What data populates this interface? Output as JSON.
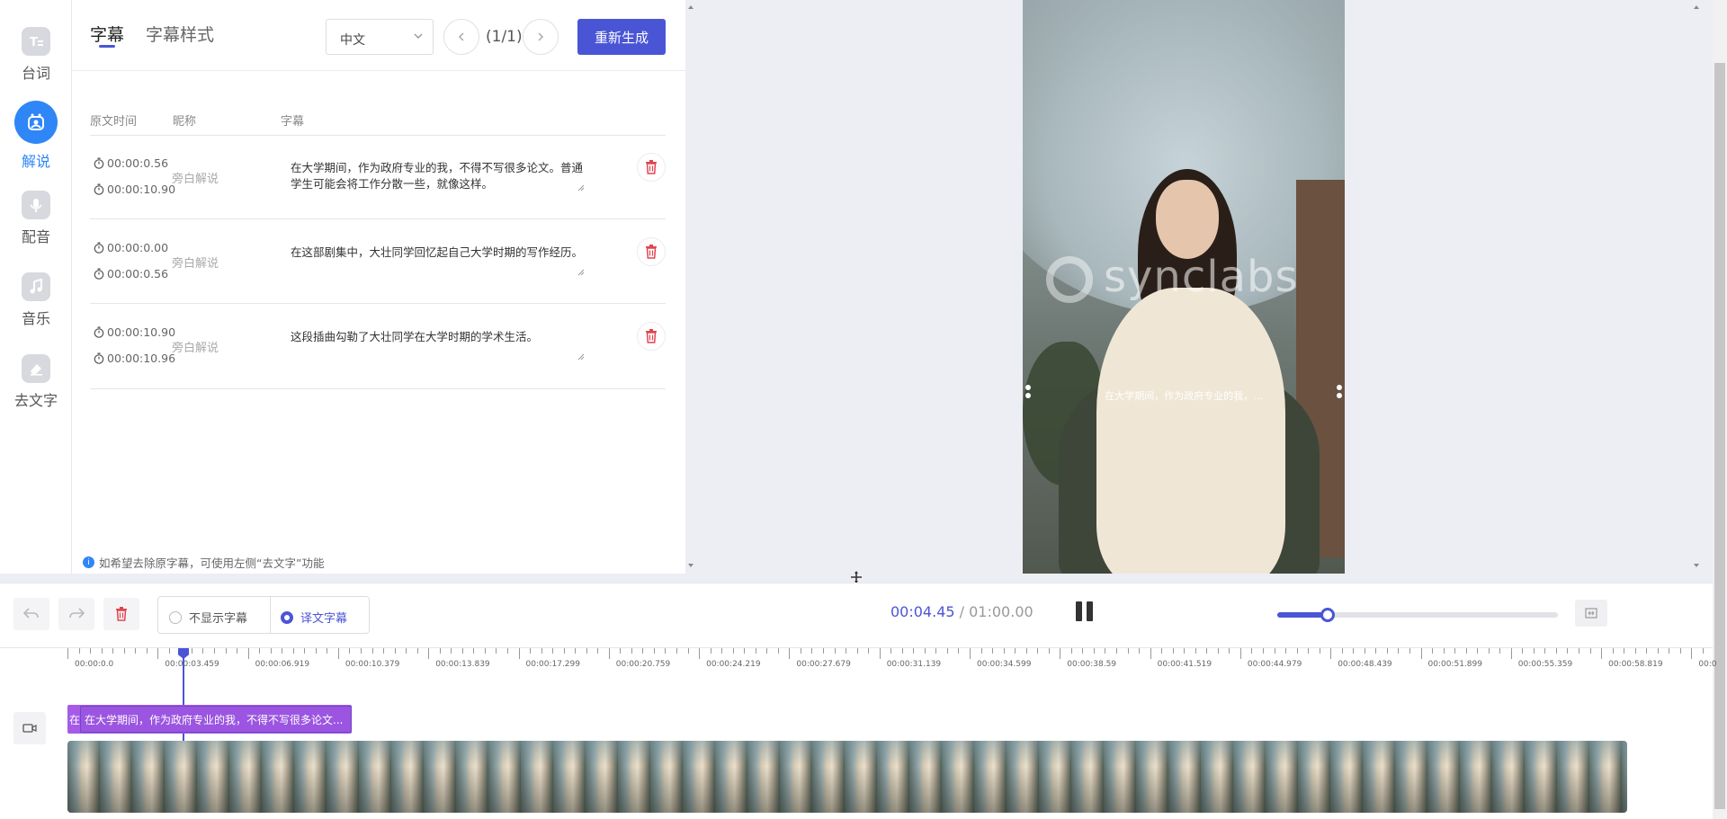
{
  "rail": {
    "items": [
      {
        "label": "台词",
        "icon": "text-icon"
      },
      {
        "label": "解说",
        "icon": "narrator-icon"
      },
      {
        "label": "配音",
        "icon": "microphone-icon"
      },
      {
        "label": "音乐",
        "icon": "music-icon"
      },
      {
        "label": "去文字",
        "icon": "eraser-icon"
      }
    ],
    "active_index": 1
  },
  "panel": {
    "tabs": [
      {
        "label": "字幕"
      },
      {
        "label": "字幕样式"
      }
    ],
    "language": "中文",
    "pager": "(1/1)",
    "regenerate_label": "重新生成",
    "columns": [
      "原文时间",
      "昵称",
      "字幕"
    ],
    "rows": [
      {
        "start": "00:00:0.56",
        "end": "00:00:10.90",
        "nickname": "旁白解说",
        "text": "在大学期间，作为政府专业的我，不得不写很多论文。普通学生可能会将工作分散一些，就像这样。"
      },
      {
        "start": "00:00:0.00",
        "end": "00:00:0.56",
        "nickname": "旁白解说",
        "text": "在这部剧集中，大壮同学回忆起自己大学时期的写作经历。"
      },
      {
        "start": "00:00:10.90",
        "end": "00:00:10.96",
        "nickname": "旁白解说",
        "text": "这段插曲勾勒了大壮同学在大学时期的学术生活。"
      }
    ],
    "hint": "如希望去除原字幕，可使用左侧“去文字”功能"
  },
  "preview": {
    "watermark": "synclabs",
    "subtitle_overlay": "在大学期间，作为政府专业的我，..."
  },
  "toolbar": {
    "radio_options": [
      "不显示字幕",
      "译文字幕"
    ],
    "selected_radio": 1,
    "time_current": "00:04.45",
    "time_total": " / 01:00.00",
    "zoom_level": 0.18
  },
  "timeline": {
    "ruler_labels": [
      "00:00:0.0",
      "00:00:03.459",
      "00:00:06.919",
      "00:00:10.379",
      "00:00:13.839",
      "00:00:17.299",
      "00:00:20.759",
      "00:00:24.219",
      "00:00:27.679",
      "00:00:31.139",
      "00:00:34.599",
      "00:00:38.59",
      "00:00:41.519",
      "00:00:44.979",
      "00:00:48.439",
      "00:00:51.899",
      "00:00:55.359",
      "00:00:58.819",
      "00:0"
    ],
    "subtitle_clip_lead": "在",
    "subtitle_clip_text": "在大学期间，作为政府专业的我，不得不写很多论文..."
  },
  "colors": {
    "accent": "#4a55d6",
    "rail_active": "#2f86f6",
    "delete": "#e0454f",
    "subtitle_clip": "#a55be6"
  }
}
